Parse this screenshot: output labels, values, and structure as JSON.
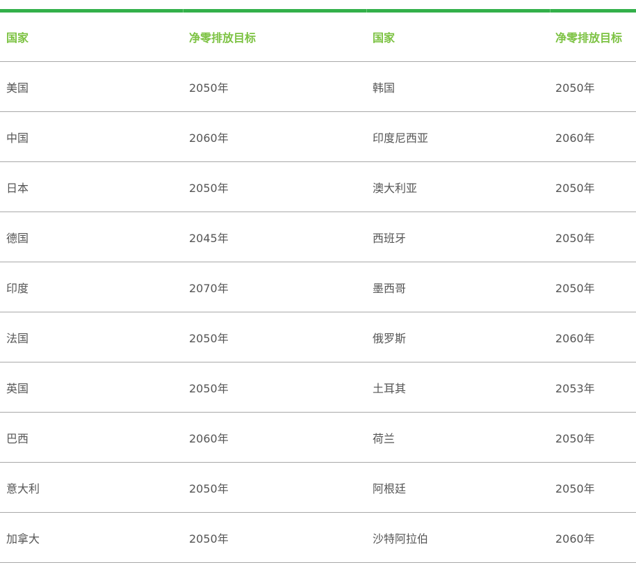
{
  "table": {
    "headers": [
      "国家",
      "净零排放目标",
      "国家",
      "净零排放目标"
    ],
    "rows": [
      [
        "美国",
        "2050年",
        "韩国",
        "2050年"
      ],
      [
        "中国",
        "2060年",
        "印度尼西亚",
        "2060年"
      ],
      [
        "日本",
        "2050年",
        "澳大利亚",
        "2050年"
      ],
      [
        "德国",
        "2045年",
        "西班牙",
        "2050年"
      ],
      [
        "印度",
        "2070年",
        "墨西哥",
        "2050年"
      ],
      [
        "法国",
        "2050年",
        "俄罗斯",
        "2060年"
      ],
      [
        "英国",
        "2050年",
        "土耳其",
        "2053年"
      ],
      [
        "巴西",
        "2060年",
        "荷兰",
        "2050年"
      ],
      [
        "意大利",
        "2050年",
        "阿根廷",
        "2050年"
      ],
      [
        "加拿大",
        "2050年",
        "沙特阿拉伯",
        "2060年"
      ]
    ]
  },
  "colors": {
    "accent_bar": "#33b04a",
    "header_text": "#7cc242",
    "body_text": "#555555",
    "divider": "#a8a8a8"
  }
}
